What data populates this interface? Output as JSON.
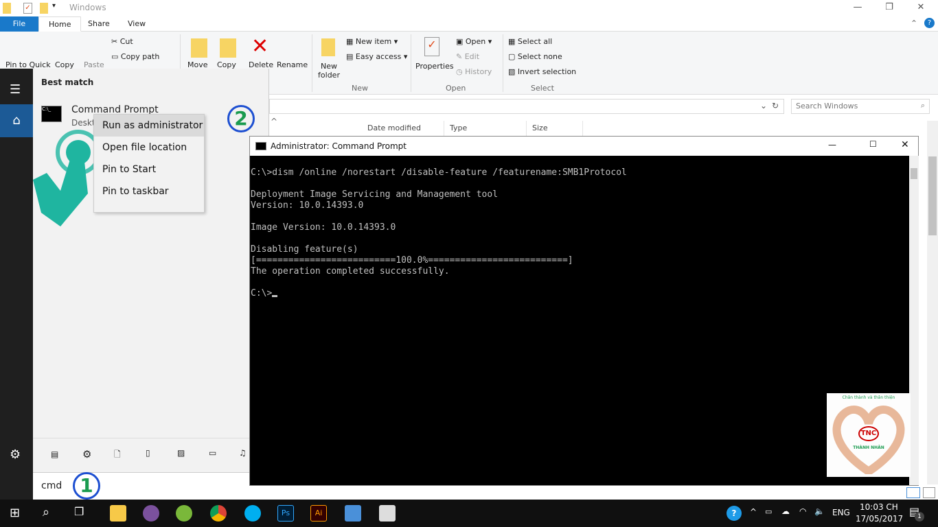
{
  "explorer": {
    "title": "Windows",
    "tabs": [
      "File",
      "Home",
      "Share",
      "View"
    ],
    "ribbon": {
      "pin": "Pin to Quick",
      "copy": "Copy",
      "paste": "Paste",
      "cut": "Cut",
      "copy_path": "Copy path",
      "move": "Move",
      "copy_to": "Copy",
      "delete": "Delete",
      "rename": "Rename",
      "new_folder": "New folder",
      "new_item": "New item",
      "easy_access": "Easy access",
      "new_group": "New",
      "properties": "Properties",
      "open": "Open",
      "edit": "Edit",
      "history": "History",
      "open_group": "Open",
      "select_all": "Select all",
      "select_none": "Select none",
      "invert": "Invert selection",
      "select_group": "Select"
    },
    "search_placeholder": "Search Windows",
    "columns": [
      "Date modified",
      "Type",
      "Size"
    ]
  },
  "start": {
    "best_match": "Best match",
    "result_title": "Command Prompt",
    "result_sub": "Deskt",
    "search_value": "cmd",
    "context_menu": [
      "Run as administrator",
      "Open file location",
      "Pin to Start",
      "Pin to taskbar"
    ]
  },
  "annotations": {
    "step1": "1",
    "step2": "2"
  },
  "cmd": {
    "title": "Administrator: Command Prompt",
    "lines": [
      "C:\\>dism /online /norestart /disable-feature /featurename:SMB1Protocol",
      "",
      "Deployment Image Servicing and Management tool",
      "Version: 10.0.14393.0",
      "",
      "Image Version: 10.0.14393.0",
      "",
      "Disabling feature(s)",
      "[==========================100.0%==========================]",
      "The operation completed successfully.",
      "",
      "C:\\>"
    ]
  },
  "watermark": {
    "slogan": "Chân thành và thân thiện",
    "brand": "TNC",
    "company": "THÀNH NHÂN"
  },
  "taskbar": {
    "lang": "ENG",
    "time": "10:03 CH",
    "date": "17/05/2017",
    "notifications": "1",
    "apps": [
      "file-explorer",
      "viber",
      "coc-coc",
      "chrome",
      "skype",
      "photoshop",
      "illustrator",
      "remote-desktop",
      "notepad"
    ]
  },
  "colors": {
    "accent": "#1979ca",
    "console_text": "#c0c0c0",
    "highlight": "#1a9b4f",
    "cursor_hand": "#1fb5a0"
  }
}
